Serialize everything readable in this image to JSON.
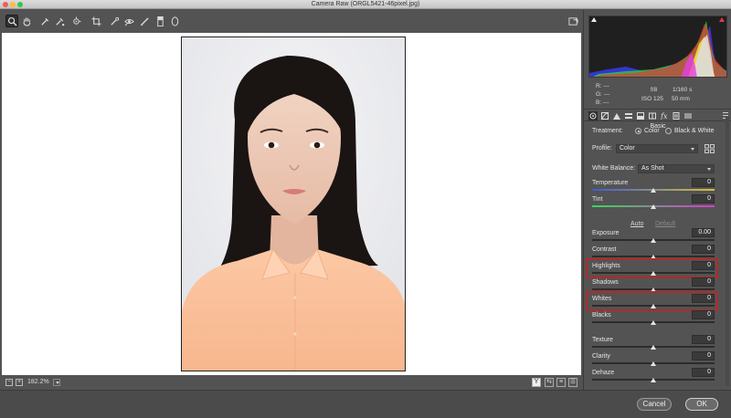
{
  "window": {
    "title": "Camera Raw (ORGL5421-46pixel.jpg)"
  },
  "toolbar": {
    "tools": [
      {
        "name": "zoom-tool"
      },
      {
        "name": "hand-tool"
      },
      {
        "name": "white-balance-tool"
      },
      {
        "name": "color-sampler-tool"
      },
      {
        "name": "targeted-adjustment-tool"
      },
      {
        "name": "crop-tool"
      },
      {
        "name": "spot-removal-tool"
      },
      {
        "name": "red-eye-tool"
      },
      {
        "name": "adjustment-brush-tool"
      },
      {
        "name": "graduated-filter-tool"
      },
      {
        "name": "radial-filter-tool"
      }
    ],
    "open_preferences_icon": "open-in-icon"
  },
  "canvas": {
    "zoom": "182.2%",
    "view_toggle_label": "Y"
  },
  "readout": {
    "r": "R:",
    "g": "G:",
    "b": "B:",
    "r_val": "---",
    "g_val": "---",
    "b_val": "---",
    "aperture": "f/8",
    "shutter": "1/160 s",
    "iso": "ISO 125",
    "focal": "50 mm"
  },
  "panel": {
    "section": "Basic",
    "treatment_label": "Treatment:",
    "treatment_color": "Color",
    "treatment_bw": "Black & White",
    "profile_label": "Profile:",
    "profile_value": "Color",
    "wb_label": "White Balance:",
    "wb_value": "As Shot",
    "auto": "Auto",
    "default": "Default"
  },
  "sliders": [
    {
      "label": "Temperature",
      "value": "0",
      "level": 0.5
    },
    {
      "label": "Tint",
      "value": "0",
      "level": 0.5
    },
    {
      "label": "Exposure",
      "value": "0.00",
      "level": 0.5
    },
    {
      "label": "Contrast",
      "value": "0",
      "level": 0.5
    },
    {
      "label": "Highlights",
      "value": "0",
      "level": 0.5
    },
    {
      "label": "Shadows",
      "value": "0",
      "level": 0.5
    },
    {
      "label": "Whites",
      "value": "0",
      "level": 0.5
    },
    {
      "label": "Blacks",
      "value": "0",
      "level": 0.5
    },
    {
      "label": "Texture",
      "value": "0",
      "level": 0.5
    },
    {
      "label": "Clarity",
      "value": "0",
      "level": 0.5
    },
    {
      "label": "Dehaze",
      "value": "0",
      "level": 0.5
    }
  ],
  "footer": {
    "cancel": "Cancel",
    "ok": "OK"
  },
  "colors": {
    "highlight_box": "#b02a2a",
    "clip_warning": "#e23b3b"
  }
}
